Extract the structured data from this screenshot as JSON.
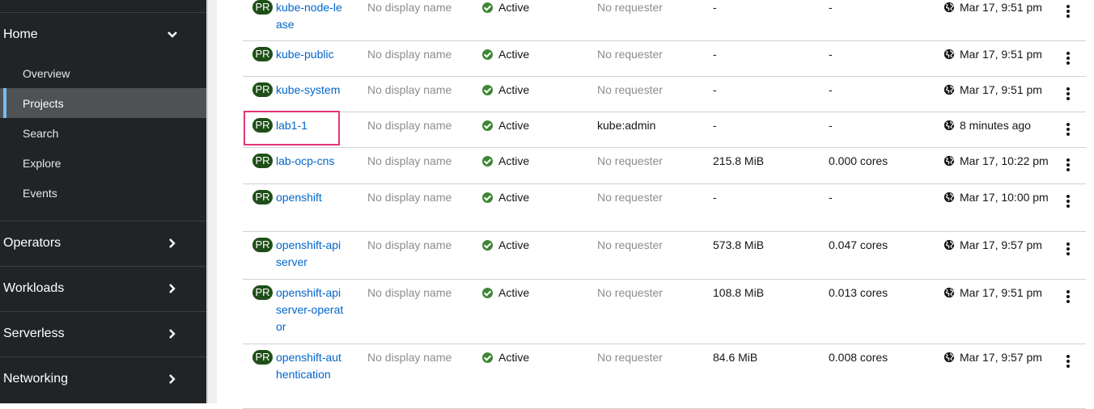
{
  "sidebar": {
    "home": {
      "label": "Home",
      "items": [
        "Overview",
        "Projects",
        "Search",
        "Explore",
        "Events"
      ]
    },
    "sections": [
      "Operators",
      "Workloads",
      "Serverless",
      "Networking"
    ]
  },
  "table": {
    "badge": "PR",
    "rows": [
      {
        "name": "kube-node-lease",
        "display": "No display name",
        "status": "Active",
        "requester": "No requester",
        "memory": "-",
        "cpu": "-",
        "created": "Mar 17, 9:51 pm"
      },
      {
        "name": "kube-public",
        "display": "No display name",
        "status": "Active",
        "requester": "No requester",
        "memory": "-",
        "cpu": "-",
        "created": "Mar 17, 9:51 pm"
      },
      {
        "name": "kube-system",
        "display": "No display name",
        "status": "Active",
        "requester": "No requester",
        "memory": "-",
        "cpu": "-",
        "created": "Mar 17, 9:51 pm"
      },
      {
        "name": "lab1-1",
        "display": "No display name",
        "status": "Active",
        "requester": "kube:admin",
        "memory": "-",
        "cpu": "-",
        "created": "8 minutes ago"
      },
      {
        "name": "lab-ocp-cns",
        "display": "No display name",
        "status": "Active",
        "requester": "No requester",
        "memory": "215.8 MiB",
        "cpu": "0.000 cores",
        "created": "Mar 17, 10:22 pm"
      },
      {
        "name": "openshift",
        "display": "No display name",
        "status": "Active",
        "requester": "No requester",
        "memory": "-",
        "cpu": "-",
        "created": "Mar 17, 10:00 pm"
      },
      {
        "name": "openshift-apiserver",
        "display": "No display name",
        "status": "Active",
        "requester": "No requester",
        "memory": "573.8 MiB",
        "cpu": "0.047 cores",
        "created": "Mar 17, 9:57 pm"
      },
      {
        "name": "openshift-apiserver-operator",
        "display": "No display name",
        "status": "Active",
        "requester": "No requester",
        "memory": "108.8 MiB",
        "cpu": "0.013 cores",
        "created": "Mar 17, 9:51 pm"
      },
      {
        "name": "openshift-authentication",
        "display": "No display name",
        "status": "Active",
        "requester": "No requester",
        "memory": "84.6 MiB",
        "cpu": "0.008 cores",
        "created": "Mar 17, 9:57 pm"
      }
    ]
  },
  "colors": {
    "sidebar_bg": "#212427",
    "link": "#0066cc",
    "active_green": "#3e8635",
    "badge_bg": "#1e4f18",
    "highlight": "#e2367a"
  }
}
